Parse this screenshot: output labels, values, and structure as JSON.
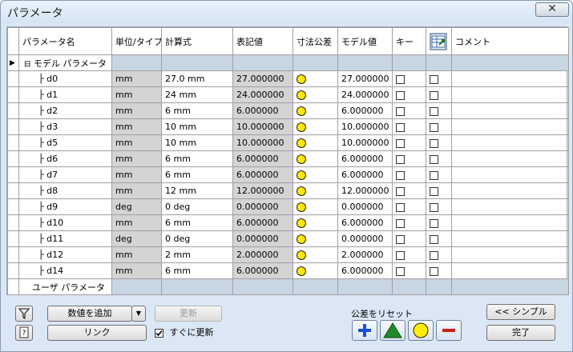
{
  "window": {
    "title": "パラメータ",
    "close_label": "✕"
  },
  "columns": [
    "パラメータ名",
    "単位/タイプ",
    "計算式",
    "表記値",
    "寸法公差",
    "モデル値",
    "キー",
    "",
    "コメント"
  ],
  "groups": {
    "model": "モデル パラメータ",
    "user": "ユーザ パラメータ"
  },
  "rows": [
    {
      "name": "d0",
      "unit": "mm",
      "expr": "27.0 mm",
      "nominal": "27.000000",
      "model": "27.000000"
    },
    {
      "name": "d1",
      "unit": "mm",
      "expr": "24 mm",
      "nominal": "24.000000",
      "model": "24.000000"
    },
    {
      "name": "d2",
      "unit": "mm",
      "expr": "6 mm",
      "nominal": "6.000000",
      "model": "6.000000"
    },
    {
      "name": "d3",
      "unit": "mm",
      "expr": "10 mm",
      "nominal": "10.000000",
      "model": "10.000000"
    },
    {
      "name": "d5",
      "unit": "mm",
      "expr": "10 mm",
      "nominal": "10.000000",
      "model": "10.000000"
    },
    {
      "name": "d6",
      "unit": "mm",
      "expr": "6 mm",
      "nominal": "6.000000",
      "model": "6.000000"
    },
    {
      "name": "d7",
      "unit": "mm",
      "expr": "6 mm",
      "nominal": "6.000000",
      "model": "6.000000"
    },
    {
      "name": "d8",
      "unit": "mm",
      "expr": "12 mm",
      "nominal": "12.000000",
      "model": "12.000000"
    },
    {
      "name": "d9",
      "unit": "deg",
      "expr": "0 deg",
      "nominal": "0.000000",
      "model": "0.000000"
    },
    {
      "name": "d10",
      "unit": "mm",
      "expr": "6 mm",
      "nominal": "6.000000",
      "model": "6.000000"
    },
    {
      "name": "d11",
      "unit": "deg",
      "expr": "0 deg",
      "nominal": "0.000000",
      "model": "0.000000"
    },
    {
      "name": "d12",
      "unit": "mm",
      "expr": "2 mm",
      "nominal": "2.000000",
      "model": "2.000000"
    },
    {
      "name": "d14",
      "unit": "mm",
      "expr": "6 mm",
      "nominal": "6.000000",
      "model": "6.000000"
    }
  ],
  "buttons": {
    "add_numeric": "数値を追加",
    "update": "更新",
    "link": "リンク",
    "immediate_update": "すぐに更新",
    "reset_tolerance": "公差をリセット",
    "simple": "<< シンプル",
    "done": "完了"
  },
  "colors": {
    "tolerance_nominal": "#ffee00",
    "tolerance_upper": "#1a4fd6",
    "tolerance_mid": "#1d8a2a",
    "tolerance_lower": "#d61a1a"
  },
  "icons": {
    "filter": "filter-icon",
    "help": "help-icon",
    "export": "export-parameter-icon"
  }
}
